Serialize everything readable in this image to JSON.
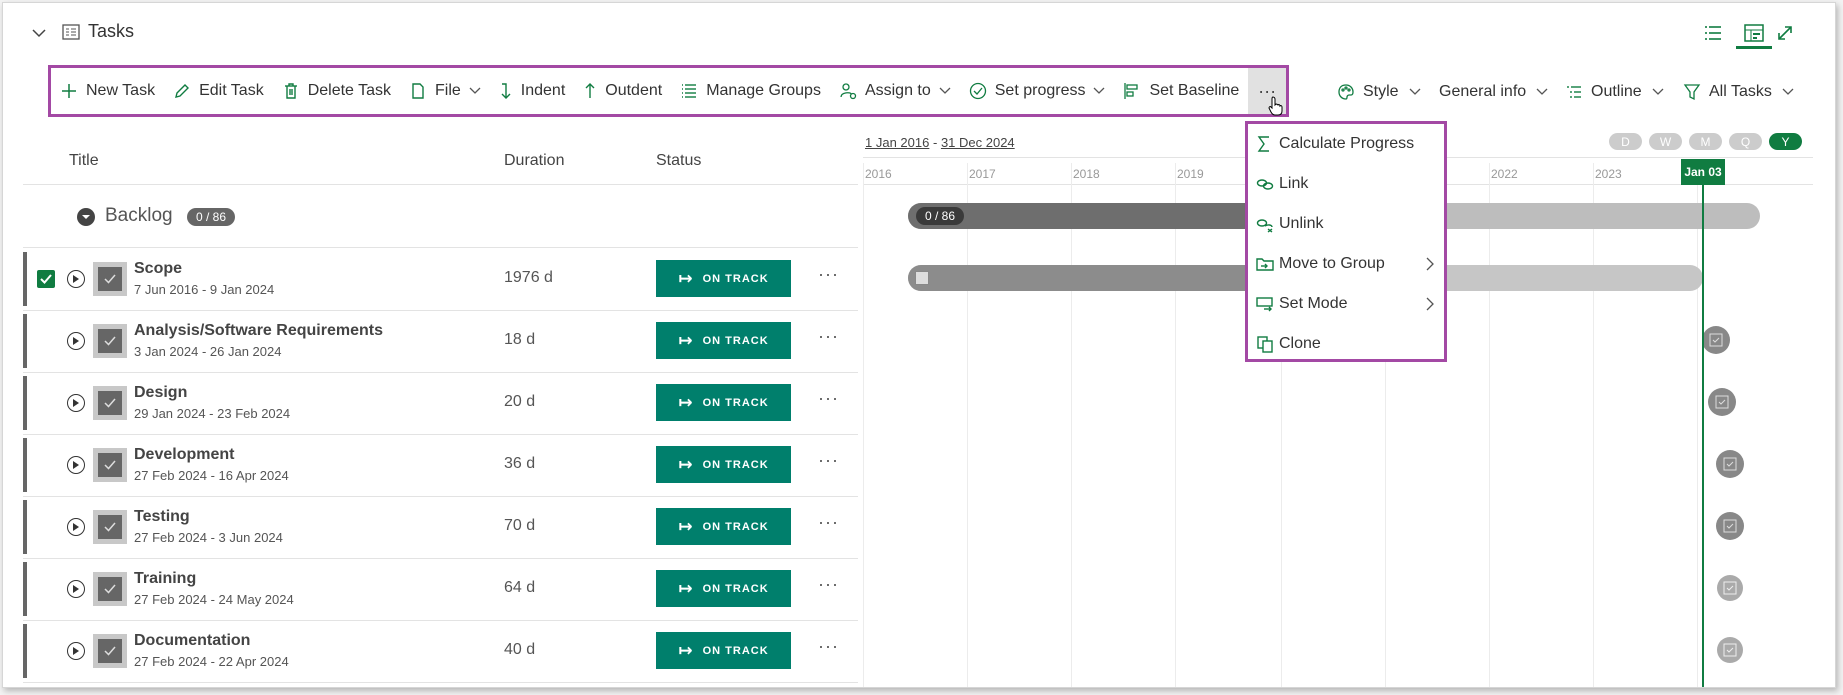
{
  "header": {
    "title": "Tasks"
  },
  "toolbar": {
    "new_task": "New Task",
    "edit_task": "Edit Task",
    "delete_task": "Delete Task",
    "file": "File",
    "indent": "Indent",
    "outdent": "Outdent",
    "manage_groups": "Manage Groups",
    "assign_to": "Assign to",
    "set_progress": "Set progress",
    "set_baseline": "Set Baseline",
    "more": "···"
  },
  "right_toolbar": {
    "style": "Style",
    "general_info": "General info",
    "outline": "Outline",
    "all_tasks": "All Tasks"
  },
  "columns": {
    "title": "Title",
    "duration": "Duration",
    "status": "Status"
  },
  "group": {
    "name": "Backlog",
    "count": "0 / 86"
  },
  "tasks": [
    {
      "name": "Scope",
      "dates": "7 Jun 2016 - 9 Jan 2024",
      "duration": "1976 d",
      "status": "ON TRACK"
    },
    {
      "name": "Analysis/Software Requirements",
      "dates": "3 Jan 2024 - 26 Jan 2024",
      "duration": "18 d",
      "status": "ON TRACK"
    },
    {
      "name": "Design",
      "dates": "29 Jan 2024 - 23 Feb 2024",
      "duration": "20 d",
      "status": "ON TRACK"
    },
    {
      "name": "Development",
      "dates": "27 Feb 2024 - 16 Apr 2024",
      "duration": "36 d",
      "status": "ON TRACK"
    },
    {
      "name": "Testing",
      "dates": "27 Feb 2024 - 3 Jun 2024",
      "duration": "70 d",
      "status": "ON TRACK"
    },
    {
      "name": "Training",
      "dates": "27 Feb 2024 - 24 May 2024",
      "duration": "64 d",
      "status": "ON TRACK"
    },
    {
      "name": "Documentation",
      "dates": "27 Feb 2024 - 22 Apr 2024",
      "duration": "40 d",
      "status": "ON TRACK"
    }
  ],
  "timeline": {
    "range_start": "1 Jan 2016",
    "range_sep": "-",
    "range_end": "31 Dec 2024",
    "years": [
      "2016",
      "2017",
      "2018",
      "2019",
      "2022",
      "2023"
    ],
    "scales": [
      "D",
      "W",
      "M",
      "Q",
      "Y"
    ],
    "today": "Jan 03",
    "group_bar_label": "0 / 86"
  },
  "menu": {
    "calculate_progress": "Calculate Progress",
    "link": "Link",
    "unlink": "Unlink",
    "move_to_group": "Move to Group",
    "set_mode": "Set Mode",
    "clone": "Clone"
  },
  "colors": {
    "accent": "#107c41",
    "status": "#007f6c",
    "highlight": "#a349a4"
  }
}
